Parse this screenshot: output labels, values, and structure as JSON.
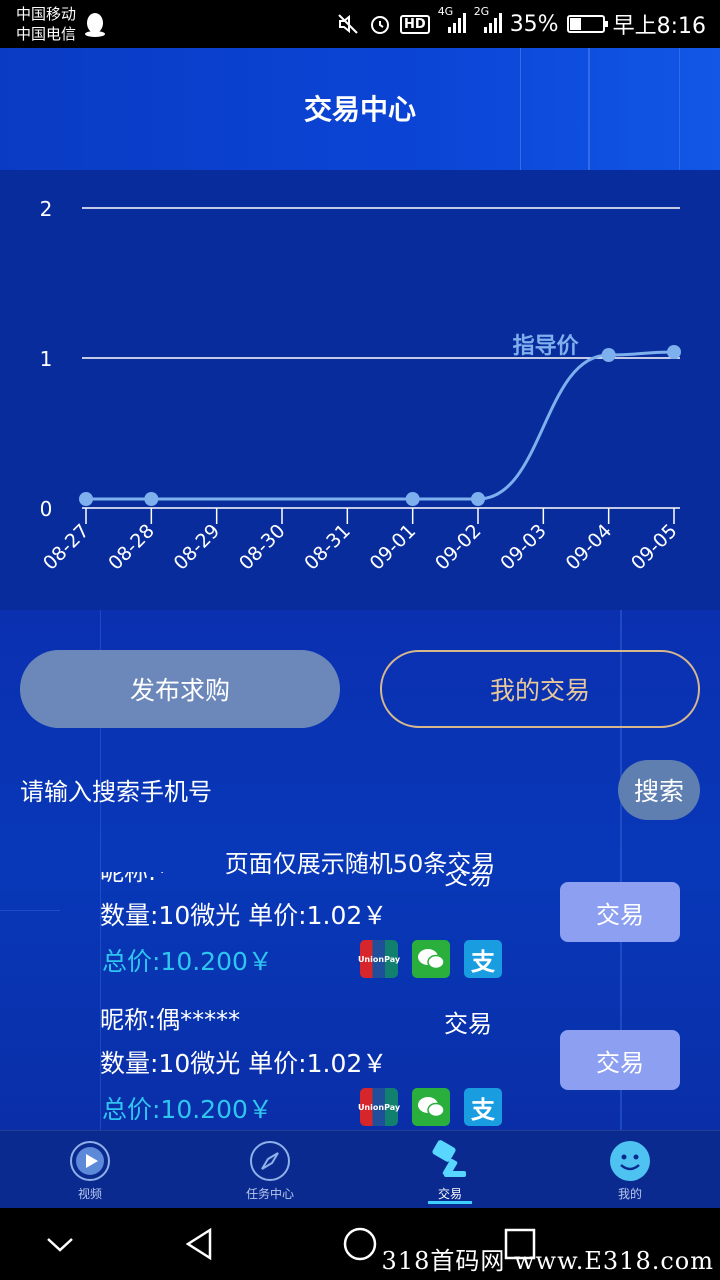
{
  "status_bar": {
    "carrier1": "中国移动",
    "carrier2": "中国电信",
    "net1": "4G",
    "net2": "2G",
    "battery": "35%",
    "battery_level": 0.35,
    "time": "早上8:16",
    "icons": [
      "qq-icon",
      "mute-icon",
      "alarm-icon",
      "hd-icon",
      "signal-icon",
      "battery-icon"
    ]
  },
  "header": {
    "title": "交易中心"
  },
  "chart_data": {
    "type": "line",
    "title": "",
    "xlabel": "",
    "ylabel": "",
    "x": [
      "08-27",
      "08-28",
      "08-29",
      "08-30",
      "08-31",
      "09-01",
      "09-02",
      "09-03",
      "09-04",
      "09-05"
    ],
    "y_ticks": [
      "0",
      "1",
      "2"
    ],
    "ylim": [
      0,
      2
    ],
    "grid": true,
    "series": [
      {
        "name": "指导价",
        "color": "#7eb0ee",
        "points": [
          {
            "x": "08-27",
            "y": 0.06
          },
          {
            "x": "08-28",
            "y": 0.06
          },
          {
            "x": "09-01",
            "y": 0.06
          },
          {
            "x": "09-02",
            "y": 0.06
          },
          {
            "x": "09-04",
            "y": 1.02
          },
          {
            "x": "09-05",
            "y": 1.04
          }
        ]
      }
    ]
  },
  "actions": {
    "publish": "发布求购",
    "my_trades": "我的交易"
  },
  "search": {
    "placeholder": "请输入搜索手机号",
    "button": "搜索"
  },
  "notice": "页面仅展示随机50条交易",
  "trades": [
    {
      "nickname": "昵称:*",
      "label": "交易",
      "qty_price": "数量:10微光 单价:1.02￥",
      "total": "总价:10.200￥",
      "button": "交易"
    },
    {
      "nickname": "昵称:偶*****",
      "label": "交易",
      "qty_price": "数量:10微光 单价:1.02￥",
      "total": "总价:10.200￥",
      "button": "交易"
    }
  ],
  "payment_icons": [
    "unionpay-icon",
    "wechat-pay-icon",
    "alipay-icon"
  ],
  "unionpay_text": "UnionPay",
  "alipay_text": "支",
  "bottom_nav": [
    {
      "label": "视频",
      "icon": "video-icon"
    },
    {
      "label": "任务中心",
      "icon": "compass-icon"
    },
    {
      "label": "交易",
      "icon": "trade-hammer-icon",
      "active": true
    },
    {
      "label": "我的",
      "icon": "smiley-icon"
    }
  ],
  "watermark": "318首码网  www.E318.com"
}
